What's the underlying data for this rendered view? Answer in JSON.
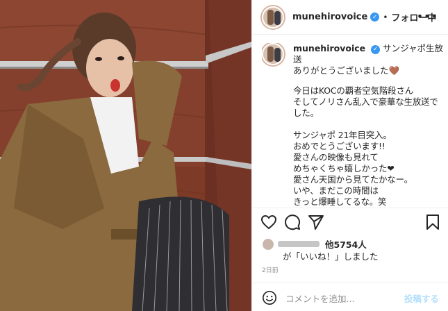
{
  "header": {
    "username": "munehirovoice",
    "verified_mark": "✓",
    "separator": "•",
    "follow_label": "フォロー中",
    "more_label": "•••"
  },
  "caption": {
    "username": "munehirovoice",
    "first_line": "サンジャポ生放送",
    "second_line": "ありがとうございました",
    "heart": "🤎",
    "body": "今日はKOCの覇者空気階段さん\nそしてノリさん乱入で豪華な生放送でした。\n\nサンジャポ 21年目突入。\nおめでとうございます!!\n愛さんの映像も見れて\nめちゃくちゃ嬉しかった❤\n愛さん天国から見てたかなー。\nいや、まだこの時間は\nきっと爆睡してるな。笑"
  },
  "actions": {
    "icons": [
      "heart-icon",
      "comment-icon",
      "share-icon",
      "bookmark-icon"
    ]
  },
  "likes": {
    "count_text": "他5754人",
    "liked_text": "が「いいね！」しました"
  },
  "timestamp": "2日前",
  "comment": {
    "placeholder": "コメントを追加...",
    "post_label": "投稿する"
  },
  "colors": {
    "verified_blue": "#3897f0",
    "post_disabled": "#b2dffc",
    "jacket": "#8a6a3e",
    "wall": "#8b4431"
  }
}
